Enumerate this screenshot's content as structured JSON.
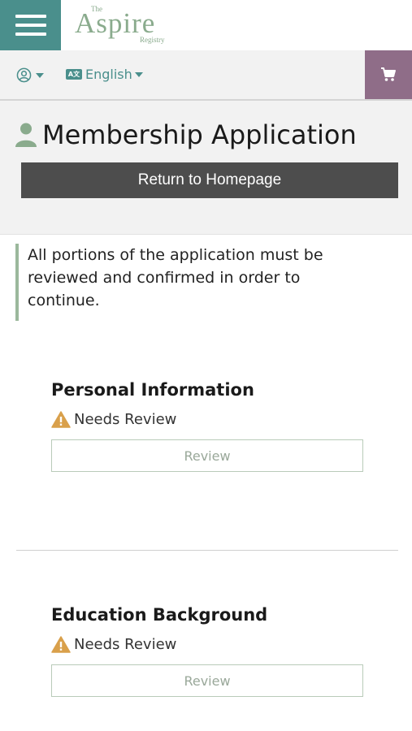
{
  "header": {
    "logo": {
      "the": "The",
      "brand": "Aspire",
      "registry": "Registry"
    },
    "language": "English"
  },
  "page": {
    "title": "Membership Application",
    "return_button": "Return to Homepage",
    "notice": "All portions of the application must be reviewed and confirmed in order to continue."
  },
  "sections": [
    {
      "title": "Personal Information",
      "status": "Needs Review",
      "button": "Review"
    },
    {
      "title": "Education Background",
      "status": "Needs Review",
      "button": "Review"
    }
  ],
  "colors": {
    "teal": "#4a8f8c",
    "sage": "#8aab8d",
    "cart": "#8f6d88",
    "warning": "#d9a04b",
    "dark_button": "#4d4d4d"
  },
  "icons": [
    "menu-icon",
    "user-circle-icon",
    "language-icon",
    "cart-icon",
    "user-icon",
    "warning-icon"
  ]
}
